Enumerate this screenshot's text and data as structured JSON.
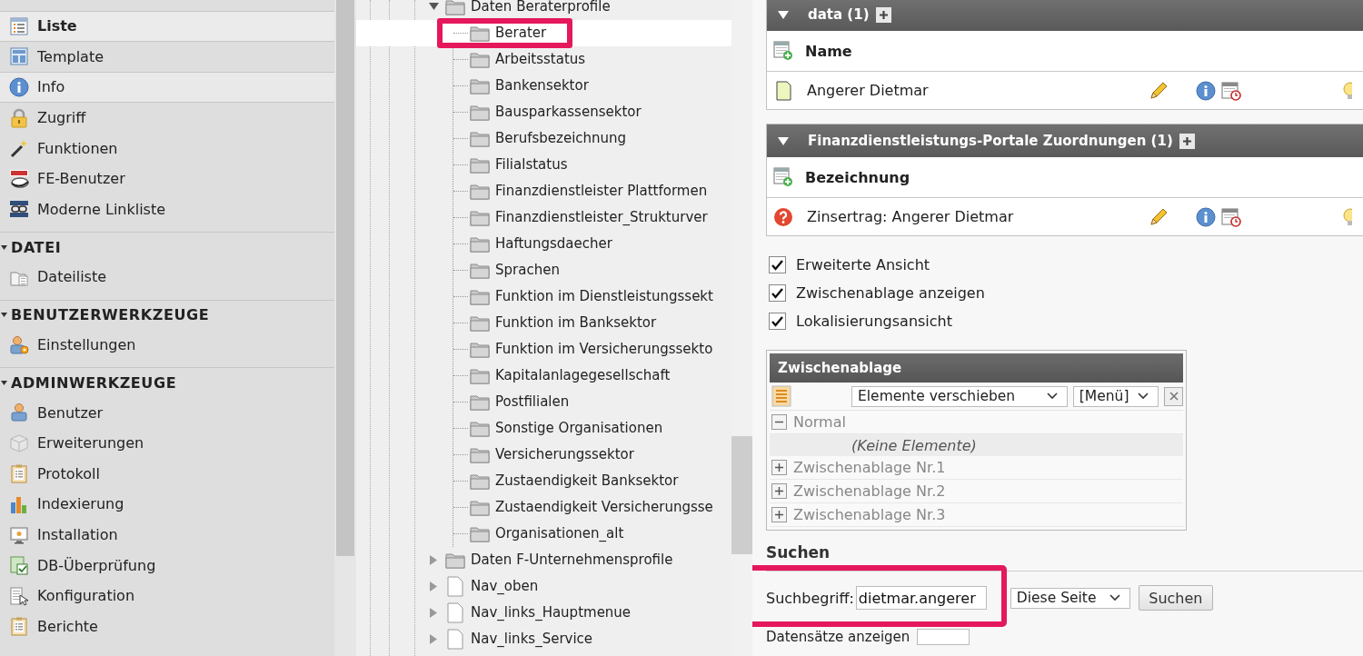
{
  "sidebar": {
    "sections": [
      {
        "items": [
          {
            "label": "Liste",
            "selected": true,
            "hovered": false
          },
          {
            "label": "Template",
            "selected": false,
            "hovered": false
          },
          {
            "label": "Info",
            "selected": false,
            "hovered": true
          },
          {
            "label": "Zugriff",
            "selected": false,
            "hovered": false
          },
          {
            "label": "Funktionen",
            "selected": false,
            "hovered": false
          },
          {
            "label": "FE-Benutzer",
            "selected": false,
            "hovered": false
          },
          {
            "label": "Moderne Linkliste",
            "selected": false,
            "hovered": false
          }
        ]
      },
      {
        "title": "DATEI",
        "expanded": true,
        "items": [
          {
            "label": "Dateiliste",
            "selected": false,
            "hovered": false
          }
        ]
      },
      {
        "title": "BENUTZERWERKZEUGE",
        "expanded": true,
        "items": [
          {
            "label": "Einstellungen",
            "selected": false,
            "hovered": false
          }
        ]
      },
      {
        "title": "ADMINWERKZEUGE",
        "expanded": true,
        "items": [
          {
            "label": "Benutzer",
            "selected": false,
            "hovered": false
          },
          {
            "label": "Erweiterungen",
            "selected": false,
            "hovered": false
          },
          {
            "label": "Protokoll",
            "selected": false,
            "hovered": false
          },
          {
            "label": "Indexierung",
            "selected": false,
            "hovered": false
          },
          {
            "label": "Installation",
            "selected": false,
            "hovered": false
          },
          {
            "label": "DB-Überprüfung",
            "selected": false,
            "hovered": false
          },
          {
            "label": "Konfiguration",
            "selected": false,
            "hovered": false
          },
          {
            "label": "Berichte",
            "selected": false,
            "hovered": false
          }
        ]
      }
    ]
  },
  "page_tree": {
    "nodes": [
      {
        "label": "Daten Beraterprofile",
        "kind": "folder",
        "expanded": true,
        "selected": false,
        "highlighted": false,
        "children": [
          {
            "label": "Berater",
            "kind": "folder",
            "selected": true,
            "highlighted": true
          },
          {
            "label": "Arbeitsstatus",
            "kind": "folder",
            "selected": false,
            "highlighted": false
          },
          {
            "label": "Bankensektor",
            "kind": "folder",
            "selected": false,
            "highlighted": false
          },
          {
            "label": "Bausparkassensektor",
            "kind": "folder",
            "selected": false,
            "highlighted": false
          },
          {
            "label": "Berufsbezeichnung",
            "kind": "folder",
            "selected": false,
            "highlighted": false
          },
          {
            "label": "Filialstatus",
            "kind": "folder",
            "selected": false,
            "highlighted": false
          },
          {
            "label": "Finanzdienstleister Plattformen",
            "kind": "folder",
            "selected": false,
            "highlighted": false
          },
          {
            "label": "Finanzdienstleister_Strukturver",
            "kind": "folder",
            "selected": false,
            "highlighted": false
          },
          {
            "label": "Haftungsdaecher",
            "kind": "folder",
            "selected": false,
            "highlighted": false
          },
          {
            "label": "Sprachen",
            "kind": "folder",
            "selected": false,
            "highlighted": false
          },
          {
            "label": "Funktion im Dienstleistungssekt",
            "kind": "folder",
            "selected": false,
            "highlighted": false
          },
          {
            "label": "Funktion im Banksektor",
            "kind": "folder",
            "selected": false,
            "highlighted": false
          },
          {
            "label": "Funktion im Versicherungssekto",
            "kind": "folder",
            "selected": false,
            "highlighted": false
          },
          {
            "label": "Kapitalanlagegesellschaft",
            "kind": "folder",
            "selected": false,
            "highlighted": false
          },
          {
            "label": "Postfilialen",
            "kind": "folder",
            "selected": false,
            "highlighted": false
          },
          {
            "label": "Sonstige Organisationen",
            "kind": "folder",
            "selected": false,
            "highlighted": false
          },
          {
            "label": "Versicherungssektor",
            "kind": "folder",
            "selected": false,
            "highlighted": false
          },
          {
            "label": "Zustaendigkeit Banksektor",
            "kind": "folder",
            "selected": false,
            "highlighted": false
          },
          {
            "label": "Zustaendigkeit Versicherungsse",
            "kind": "folder",
            "selected": false,
            "highlighted": false
          },
          {
            "label": "Organisationen_alt",
            "kind": "folder",
            "selected": false,
            "highlighted": false
          }
        ]
      },
      {
        "label": "Daten F-Unternehmensprofile",
        "kind": "folder",
        "expanded": false,
        "selected": false,
        "highlighted": false
      },
      {
        "label": "Nav_oben",
        "kind": "page",
        "expanded": false,
        "selected": false,
        "highlighted": false
      },
      {
        "label": "Nav_links_Hauptmenue",
        "kind": "page",
        "expanded": false,
        "selected": false,
        "highlighted": false
      },
      {
        "label": "Nav_links_Service",
        "kind": "page",
        "expanded": false,
        "selected": false,
        "highlighted": false
      }
    ]
  },
  "record_sections": [
    {
      "title": "data (1)",
      "expanded": true,
      "column": "Name",
      "rows": [
        {
          "label": "Angerer Dietmar",
          "kind": "page"
        }
      ]
    },
    {
      "title": "Finanzdienstleistungs-Portale Zuordnungen (1)",
      "expanded": true,
      "column": "Bezeichnung",
      "rows": [
        {
          "label": "Zinsertrag: Angerer Dietmar",
          "kind": "unknown"
        }
      ]
    }
  ],
  "options": [
    {
      "label": "Erweiterte Ansicht",
      "checked": true
    },
    {
      "label": "Zwischenablage anzeigen",
      "checked": true
    },
    {
      "label": "Lokalisierungsansicht",
      "checked": true
    }
  ],
  "clipboard": {
    "title": "Zwischenablage",
    "action": "Elemente verschieben",
    "menu": "[Menü]",
    "pads": [
      {
        "label": "Normal",
        "expanded": true,
        "empty_text": "(Keine Elemente)"
      },
      {
        "label": "Zwischenablage Nr.1",
        "expanded": false
      },
      {
        "label": "Zwischenablage Nr.2",
        "expanded": false
      },
      {
        "label": "Zwischenablage Nr.3",
        "expanded": false
      }
    ]
  },
  "search": {
    "heading": "Suchen",
    "label": "Suchbegriff:",
    "value": "dietmar.angerer",
    "scope": "Diese Seite",
    "button": "Suchen",
    "records_label": "Datensätze anzeigen",
    "highlighted": true
  }
}
